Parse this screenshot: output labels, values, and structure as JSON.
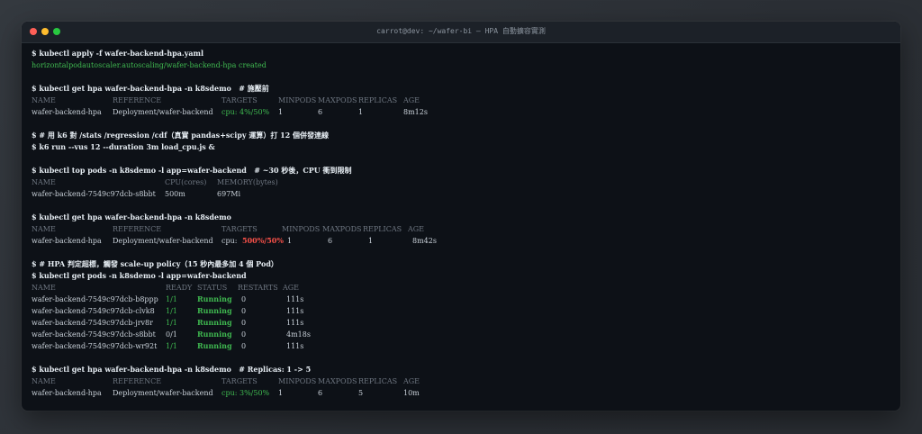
{
  "window": {
    "title": "carrot@dev: ~/wafer-bi — HPA 自動擴容實測",
    "colors": {
      "close": "#ff5f57",
      "minimize": "#febc2e",
      "zoom": "#28c840"
    }
  },
  "blocks": {
    "b1": {
      "cmd": "$ kubectl apply -f wafer-backend-hpa.yaml",
      "out": "horizontalpodautoscaler.autoscaling/wafer-backend-hpa created"
    },
    "b2": {
      "cmd": "$ kubectl get hpa wafer-backend-hpa -n k8sdemo   # 施壓前",
      "headers": [
        "NAME",
        "REFERENCE",
        "TARGETS",
        "MINPODS",
        "MAXPODS",
        "REPLICAS",
        "AGE"
      ],
      "row": {
        "name": "wafer-backend-hpa",
        "reference": "Deployment/wafer-backend",
        "targets": "cpu: 4%/50%",
        "minpods": "1",
        "maxpods": "6",
        "replicas": "1",
        "age": "8m12s"
      }
    },
    "b3": {
      "comment": "$ # 用 k6 對 /stats /regression /cdf（真實 pandas+scipy 運算）打 12 個併發連線",
      "cmd": "$ k6 run --vus 12 --duration 3m load_cpu.js &"
    },
    "b4": {
      "cmd": "$ kubectl top pods -n k8sdemo -l app=wafer-backend   # ~30 秒後，CPU 衝到限制",
      "headers": [
        "NAME",
        "CPU(cores)",
        "MEMORY(bytes)"
      ],
      "row": {
        "name": "wafer-backend-7549c97dcb-s8bbt",
        "cpu": "500m",
        "memory": "697Mi"
      }
    },
    "b5": {
      "cmd": "$ kubectl get hpa wafer-backend-hpa -n k8sdemo",
      "headers": [
        "NAME",
        "REFERENCE",
        "TARGETS",
        "MINPODS",
        "MAXPODS",
        "REPLICAS",
        "AGE"
      ],
      "row": {
        "name": "wafer-backend-hpa",
        "reference": "Deployment/wafer-backend",
        "targets_prefix": "cpu: ",
        "targets_value": "500%/50%",
        "minpods": "1",
        "maxpods": "6",
        "replicas": "1",
        "age": "8m42s"
      }
    },
    "b6": {
      "comment": "$ # HPA 判定超標，觸發 scale-up policy（15 秒內最多加 4 個 Pod）",
      "cmd": "$ kubectl get pods -n k8sdemo -l app=wafer-backend",
      "headers": [
        "NAME",
        "READY",
        "STATUS",
        "RESTARTS",
        "AGE"
      ],
      "rows": [
        {
          "name": "wafer-backend-7549c97dcb-b8ppp",
          "ready": "1/1",
          "status": "Running",
          "restarts": "0",
          "age": "111s"
        },
        {
          "name": "wafer-backend-7549c97dcb-clvk8",
          "ready": "1/1",
          "status": "Running",
          "restarts": "0",
          "age": "111s"
        },
        {
          "name": "wafer-backend-7549c97dcb-jrv8r",
          "ready": "1/1",
          "status": "Running",
          "restarts": "0",
          "age": "111s"
        },
        {
          "name": "wafer-backend-7549c97dcb-s8bbt",
          "ready": "0/1",
          "status": "Running",
          "restarts": "0",
          "age": "4m18s"
        },
        {
          "name": "wafer-backend-7549c97dcb-wr92t",
          "ready": "1/1",
          "status": "Running",
          "restarts": "0",
          "age": "111s"
        }
      ]
    },
    "b7": {
      "cmd": "$ kubectl get hpa wafer-backend-hpa -n k8sdemo   # Replicas: 1 -> 5",
      "headers": [
        "NAME",
        "REFERENCE",
        "TARGETS",
        "MINPODS",
        "MAXPODS",
        "REPLICAS",
        "AGE"
      ],
      "row": {
        "name": "wafer-backend-hpa",
        "reference": "Deployment/wafer-backend",
        "targets": "cpu: 3%/50%",
        "minpods": "1",
        "maxpods": "6",
        "replicas": "5",
        "age": "10m"
      }
    }
  }
}
